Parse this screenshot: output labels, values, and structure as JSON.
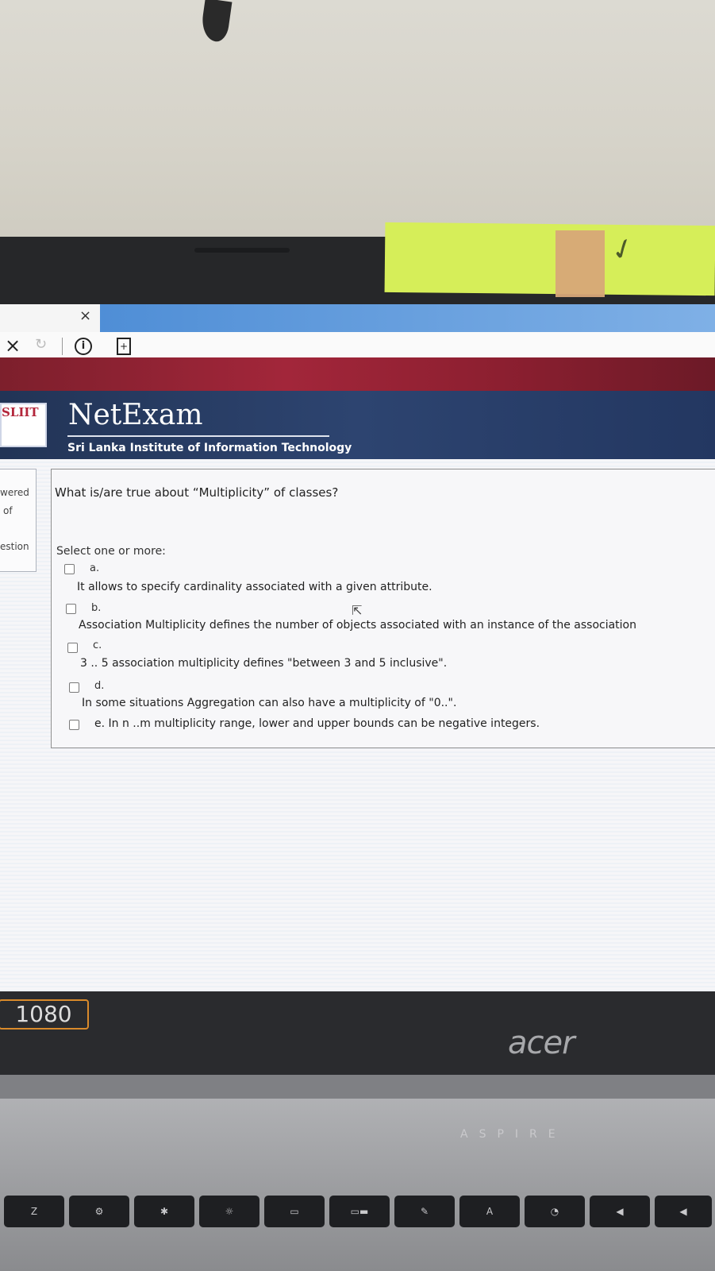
{
  "browser": {
    "tab_close": "×",
    "nav_close": "×",
    "nav_reload": "↻",
    "info_icon": "i"
  },
  "header": {
    "logo_text": "SLIIT",
    "brand": "NetExam",
    "institute": "Sri Lanka Institute of Information Technology"
  },
  "side_panel": {
    "lines": [
      "wered",
      "of",
      "estion"
    ]
  },
  "quiz": {
    "question": "What is/are true about “Multiplicity” of classes?",
    "select_label": "Select one or more:",
    "options": [
      {
        "letter": "a.",
        "text": "It allows to specify cardinality associated with a given attribute."
      },
      {
        "letter": "b.",
        "text": "Association Multiplicity defines the number of objects associated with an instance of the association"
      },
      {
        "letter": "c.",
        "text": "3 .. 5 association multiplicity defines \"between 3 and 5 inclusive\"."
      },
      {
        "letter": "d.",
        "text": "In some situations Aggregation can also have a multiplicity of \"0..\"."
      },
      {
        "letter": "",
        "text": "e. In n ..m  multiplicity range, lower and upper bounds can be negative integers."
      }
    ]
  },
  "laptop": {
    "badge": "1080",
    "brand": "acer",
    "series": "ASPIRE",
    "keys": [
      "Z",
      "⚙",
      "✱",
      "☼",
      "▭",
      "▭▬",
      "✎",
      "A",
      "◔",
      "◀",
      "◀"
    ]
  },
  "colors": {
    "header_bg": "#2d4470",
    "red_band": "#a2263a",
    "sticky_note": "#d6ee59"
  }
}
